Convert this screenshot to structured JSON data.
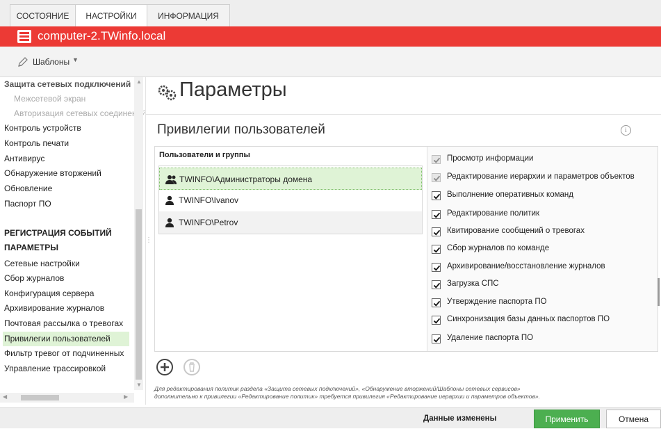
{
  "tabs": [
    "СОСТОЯНИЕ",
    "НАСТРОЙКИ",
    "ИНФОРМАЦИЯ"
  ],
  "active_tab": "НАСТРОЙКИ",
  "host": {
    "name": "computer-2.TWinfo.local",
    "icon": "server-icon"
  },
  "toolbar": {
    "templates_label": "Шаблоны",
    "templates_icon": "pencil-icon",
    "caret": "▼"
  },
  "sidebar": {
    "items": [
      "Защита сетевых подключений",
      "Межсетевой экран",
      "Авторизация сетевых соединений",
      "Контроль устройств",
      "Контроль печати",
      "Антивирус",
      "Обнаружение вторжений",
      "Обновление",
      "Паспорт ПО",
      "РЕГИСТРАЦИЯ СОБЫТИЙ",
      "ПАРАМЕТРЫ",
      "Сетевые настройки",
      "Сбор журналов",
      "Конфигурация сервера",
      "Архивирование журналов",
      "Почтовая рассылка о тревогах",
      "Привилегии пользователей",
      "Фильтр тревог от подчиненных",
      "Управление трассировкой"
    ],
    "active_item": "Привилегии пользователей"
  },
  "main": {
    "page_title": "Параметры",
    "section_title": "Привилегии пользователей",
    "users_header": "Пользователи и группы",
    "users": [
      {
        "name": "TWINFO\\Администраторы домена",
        "icon": "group-icon",
        "selected": true
      },
      {
        "name": "TWINFO\\Ivanov",
        "icon": "user-icon",
        "selected": false
      },
      {
        "name": "TWINFO\\Petrov",
        "icon": "user-icon",
        "selected": false
      }
    ],
    "permissions": [
      {
        "label": "Просмотр информации",
        "checked": true,
        "disabled": true
      },
      {
        "label": "Редактирование иерархии и параметров объектов",
        "checked": true,
        "disabled": true
      },
      {
        "label": "Выполнение оперативных команд",
        "checked": true,
        "disabled": false
      },
      {
        "label": "Редактирование политик",
        "checked": true,
        "disabled": false
      },
      {
        "label": "Квитирование сообщений о тревогах",
        "checked": true,
        "disabled": false
      },
      {
        "label": "Сбор журналов по команде",
        "checked": true,
        "disabled": false
      },
      {
        "label": "Архивирование/восстановление журналов",
        "checked": true,
        "disabled": false
      },
      {
        "label": "Загрузка СПС",
        "checked": true,
        "disabled": false
      },
      {
        "label": "Утверждение паспорта ПО",
        "checked": true,
        "disabled": false
      },
      {
        "label": "Синхронизация базы данных паспортов ПО",
        "checked": true,
        "disabled": false
      },
      {
        "label": "Удаление паспорта ПО",
        "checked": true,
        "disabled": false
      }
    ],
    "note_line1": "Для редактирования политик раздела «Защита сетевых подключений», «Обнаружение вторжений/Шаблоны сетевых сервисов»",
    "note_line2": "дополнительно к привилегии «Редактирование политик» требуется привилегия «Редактирование иерархии и параметров объектов»."
  },
  "footer": {
    "status": "Данные изменены",
    "apply": "Применить",
    "cancel": "Отмена"
  },
  "colors": {
    "host_bar": "#ec3a35",
    "apply": "#4caf50",
    "selection": "#dff3d6"
  }
}
